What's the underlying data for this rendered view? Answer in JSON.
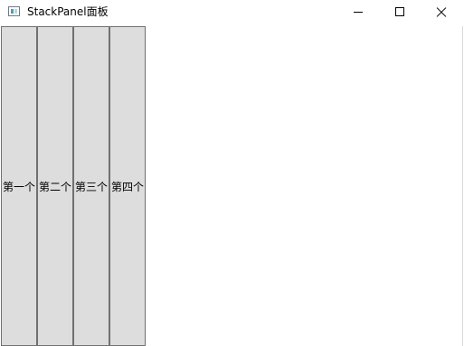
{
  "window": {
    "title": "StackPanel面板"
  },
  "caption_buttons": {
    "minimize": "minimize-icon",
    "maximize": "maximize-icon",
    "close": "close-icon"
  },
  "stack_panel": {
    "buttons": [
      {
        "label": "第一个"
      },
      {
        "label": "第二个"
      },
      {
        "label": "第三个"
      },
      {
        "label": "第四个"
      }
    ]
  }
}
